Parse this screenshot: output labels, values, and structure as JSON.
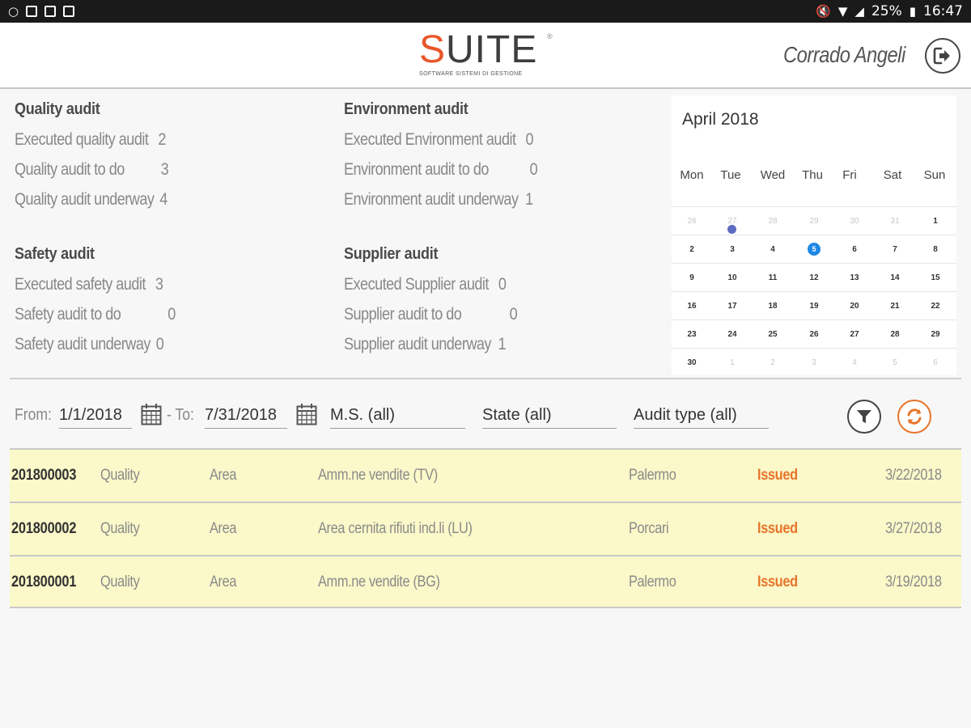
{
  "statusbar": {
    "battery": "25%",
    "time": "16:47"
  },
  "header": {
    "logo_s": "S",
    "logo_rest": "UITE",
    "logo_reg": "®",
    "logo_subtitle": "SOFTWARE SISTEMI DI GESTIONE",
    "username": "Corrado Angeli",
    "logout_icon": "logout-icon"
  },
  "summary": {
    "quality": {
      "title": "Quality audit",
      "rows": [
        {
          "label": "Executed quality audit",
          "value": "2"
        },
        {
          "label": "Quality audit to do",
          "value": "3"
        },
        {
          "label": "Quality audit underway",
          "value": "4"
        }
      ]
    },
    "environment": {
      "title": "Environment audit",
      "rows": [
        {
          "label": "Executed Environment audit",
          "value": "0"
        },
        {
          "label": "Environment audit to do",
          "value": "0"
        },
        {
          "label": "Environment audit underway",
          "value": "1"
        }
      ]
    },
    "safety": {
      "title": "Safety audit",
      "rows": [
        {
          "label": "Executed safety audit",
          "value": "3"
        },
        {
          "label": "Safety audit to do",
          "value": "0"
        },
        {
          "label": "Safety audit underway",
          "value": "0"
        }
      ]
    },
    "supplier": {
      "title": "Supplier audit",
      "rows": [
        {
          "label": "Executed Supplier audit",
          "value": "0"
        },
        {
          "label": "Supplier audit to do",
          "value": "0"
        },
        {
          "label": "Supplier audit underway",
          "value": "1"
        }
      ]
    }
  },
  "calendar": {
    "title": "April 2018",
    "weekdays": [
      "Mon",
      "Tue",
      "Wed",
      "Thu",
      "Fri",
      "Sat",
      "Sun"
    ],
    "weeks": [
      [
        "26",
        "27",
        "28",
        "29",
        "30",
        "31",
        "1"
      ],
      [
        "2",
        "3",
        "4",
        "5",
        "6",
        "7",
        "8"
      ],
      [
        "9",
        "10",
        "11",
        "12",
        "13",
        "14",
        "15"
      ],
      [
        "16",
        "17",
        "18",
        "19",
        "20",
        "21",
        "22"
      ],
      [
        "23",
        "24",
        "25",
        "26",
        "27",
        "28",
        "29"
      ],
      [
        "30",
        "1",
        "2",
        "3",
        "4",
        "5",
        "6"
      ]
    ],
    "today": "5",
    "event_day": "27",
    "today_color": "#1e88e5",
    "event_color": "#5c6bc0"
  },
  "filters": {
    "from_label": "From:",
    "from_value": "1/1/2018",
    "separator": "- To:",
    "to_value": "7/31/2018",
    "ms": "M.S. (all)",
    "state": "State (all)",
    "audit_type": "Audit type (all)",
    "filter_icon": "filter-icon",
    "refresh_icon": "refresh-icon",
    "accent_color": "#e8742a"
  },
  "audits": [
    {
      "id": "201800003",
      "type": "Quality",
      "scope": "Area",
      "site": "Amm.ne vendite (TV)",
      "city": "Palermo",
      "status": "Issued",
      "date": "3/22/2018"
    },
    {
      "id": "201800002",
      "type": "Quality",
      "scope": "Area",
      "site": "Area cernita rifiuti ind.li (LU)",
      "city": "Porcari",
      "status": "Issued",
      "date": "3/27/2018"
    },
    {
      "id": "201800001",
      "type": "Quality",
      "scope": "Area",
      "site": "Amm.ne vendite (BG)",
      "city": "Palermo",
      "status": "Issued",
      "date": "3/19/2018"
    }
  ]
}
